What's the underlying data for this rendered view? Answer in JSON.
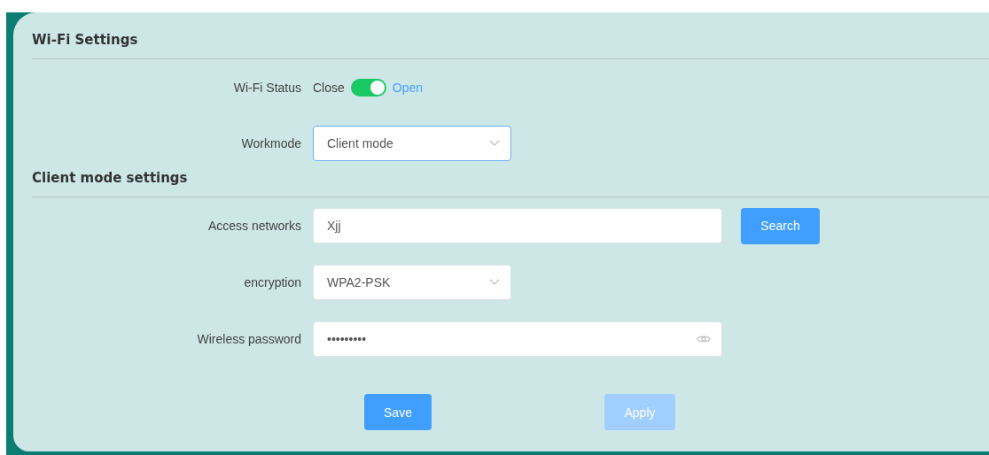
{
  "sections": [
    {
      "title": "Wi-Fi Settings",
      "fields": [
        {
          "kind": "switch",
          "label": "Wi-Fi Status",
          "off_label": "Close",
          "on_label": "Open",
          "on": true
        },
        {
          "kind": "select",
          "label": "Workmode",
          "value": "Client mode",
          "focused": true
        }
      ]
    },
    {
      "title": "Client mode settings",
      "fields": [
        {
          "kind": "text",
          "label": "Access networks",
          "value": "Xjj",
          "button": {
            "label": "Search",
            "disabled": false
          }
        },
        {
          "kind": "select",
          "label": "encryption",
          "value": "WPA2-PSK",
          "focused": false
        },
        {
          "kind": "password",
          "label": "Wireless password",
          "value": "•••••••••"
        }
      ]
    }
  ],
  "buttons": [
    {
      "label": "Save",
      "disabled": false
    },
    {
      "label": "Apply",
      "disabled": true
    }
  ]
}
